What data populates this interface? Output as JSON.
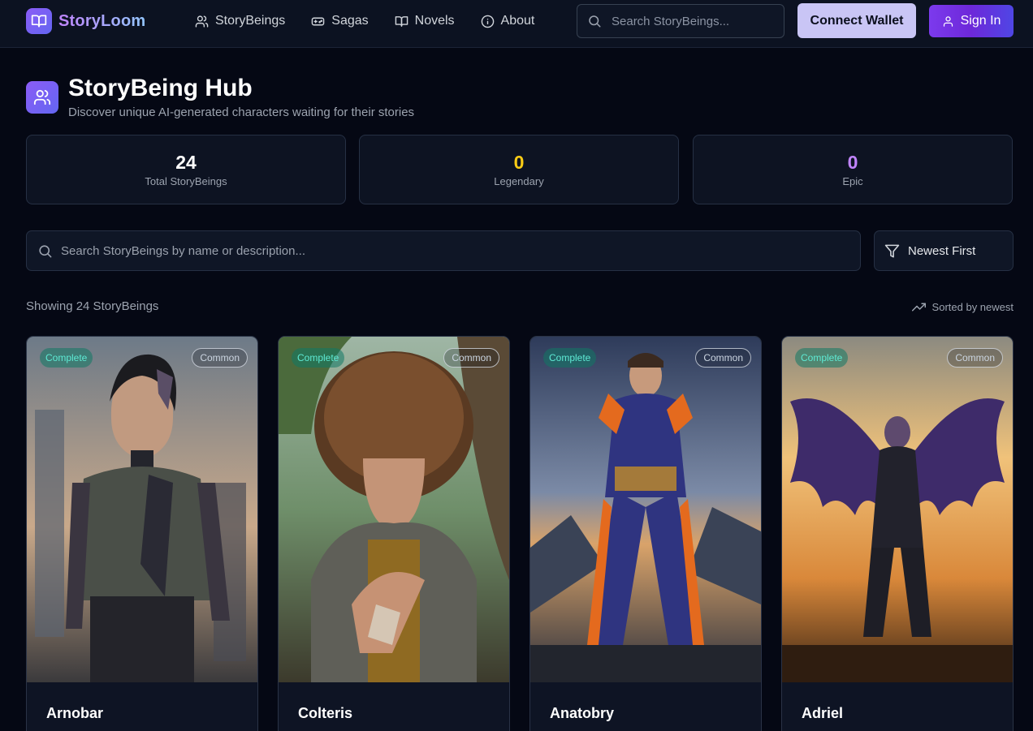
{
  "nav": {
    "brand": "StoryLoom",
    "links": [
      {
        "label": "StoryBeings",
        "icon": "users-icon"
      },
      {
        "label": "Sagas",
        "icon": "gamepad-icon"
      },
      {
        "label": "Novels",
        "icon": "book-open-icon"
      },
      {
        "label": "About",
        "icon": "info-icon"
      }
    ],
    "search_placeholder": "Search StoryBeings...",
    "connect_wallet": "Connect Wallet",
    "sign_in": "Sign In"
  },
  "header": {
    "title": "StoryBeing Hub",
    "subtitle": "Discover unique AI-generated characters waiting for their stories"
  },
  "stats": [
    {
      "value": "24",
      "label": "Total StoryBeings",
      "color": "#ffffff"
    },
    {
      "value": "0",
      "label": "Legendary",
      "color": "#facc15"
    },
    {
      "value": "0",
      "label": "Epic",
      "color": "#c084fc"
    }
  ],
  "filters": {
    "search_placeholder": "Search StoryBeings by name or description...",
    "sort_selected": "Newest First"
  },
  "results": {
    "showing": "Showing 24 StoryBeings",
    "sorted": "Sorted by newest"
  },
  "cards": [
    {
      "name": "Arnobar",
      "status": "Complete",
      "rarity": "Common"
    },
    {
      "name": "Colteris",
      "status": "Complete",
      "rarity": "Common"
    },
    {
      "name": "Anatobry",
      "status": "Complete",
      "rarity": "Common"
    },
    {
      "name": "Adriel",
      "status": "Complete",
      "rarity": "Common"
    }
  ],
  "colors": {
    "background": "#050814",
    "accent": "#7c3aed",
    "complete_badge": "#5eead4"
  }
}
